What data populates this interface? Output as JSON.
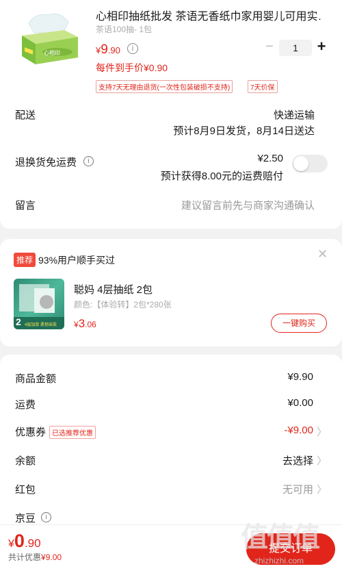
{
  "product": {
    "title": "心相印抽纸批发 茶语无香纸巾家用婴儿可用实…",
    "spec": "茶语100抽- 1包",
    "price_currency": "¥",
    "price_int": "9",
    "price_dec": ".90",
    "info_glyph": "i",
    "hand_price": "每件到手价¥0.90",
    "quantity": "1",
    "minus_glyph": "−",
    "plus_glyph": "+",
    "tag_return": "支持7天无理由退货(一次性包装破损不支持)",
    "tag_price_protect": "7天价保",
    "brand_text": "心相印"
  },
  "delivery": {
    "label": "配送",
    "method": "快递运输",
    "estimate": "预计8月9日发货，8月14日送达"
  },
  "return_fee": {
    "label": "退换货免运费",
    "info_glyph": "i",
    "price": "¥2.50",
    "desc": "预计获得8.00元的运费赔付"
  },
  "message": {
    "label": "留言",
    "placeholder": "建议留言前先与商家沟通确认"
  },
  "recommend": {
    "badge": "推荐",
    "title": "93%用户顺手买过",
    "close_glyph": "✕",
    "item_name": "聪妈 4层抽纸 2包",
    "item_spec": "颜色:【体验转】2包*280张",
    "price_currency": "¥",
    "price_int": "3",
    "price_dec": ".06",
    "buy_label": "一键购买",
    "thumb_count": "2",
    "thumb_caption": "4层加厚 柔韧亲肤"
  },
  "summary": {
    "rows": [
      {
        "label": "商品金额",
        "value": "¥9.90"
      },
      {
        "label": "运费",
        "value": "¥0.00"
      },
      {
        "label": "优惠券",
        "tag": "已选推荐优惠",
        "value": "-¥9.00",
        "chevron": "〉"
      },
      {
        "label": "余额",
        "value": "去选择",
        "chevron": "〉"
      },
      {
        "label": "红包",
        "value": "无可用",
        "chevron": "〉"
      },
      {
        "label": "京豆",
        "info_glyph": "i"
      }
    ]
  },
  "bottom": {
    "currency": "¥",
    "total_int": "0",
    "total_dec": ".90",
    "discount_label": "共计优惠",
    "discount_value": "¥9.00",
    "submit_label": "提交订单"
  },
  "watermark": {
    "main": "值值值",
    "sub": "zhizhizhi.com"
  },
  "colors": {
    "accent": "#e1251b",
    "background": "#f2f2f2"
  }
}
